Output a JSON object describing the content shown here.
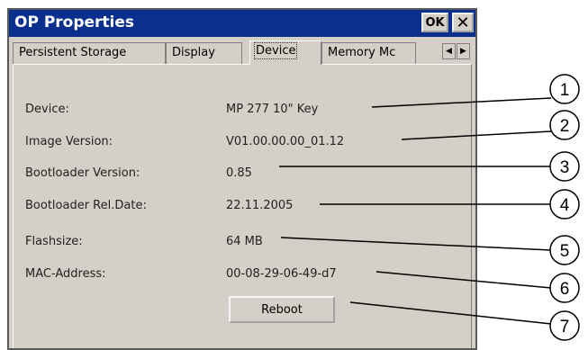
{
  "window": {
    "title": "OP Properties",
    "ok_label": "OK",
    "close_label": "✕"
  },
  "tabs": [
    {
      "label": "Persistent Storage",
      "active": false
    },
    {
      "label": "Display",
      "active": false
    },
    {
      "label": "Device",
      "active": true
    },
    {
      "label": "Memory Mc",
      "active": false
    }
  ],
  "tab_scroll": {
    "left": "◀",
    "right": "▶"
  },
  "properties": [
    {
      "label": "Device:",
      "value": "MP 277 10\" Key"
    },
    {
      "label": "Image Version:",
      "value": "V01.00.00.00_01.12"
    },
    {
      "label": "Bootloader Version:",
      "value": "0.85"
    },
    {
      "label": "Bootloader Rel.Date:",
      "value": "22.11.2005"
    },
    {
      "label": "Flashsize:",
      "value": "64 MB"
    },
    {
      "label": "MAC-Address:",
      "value": "00-08-29-06-49-d7"
    }
  ],
  "reboot_label": "Reboot",
  "callouts": [
    "1",
    "2",
    "3",
    "4",
    "5",
    "6",
    "7"
  ]
}
